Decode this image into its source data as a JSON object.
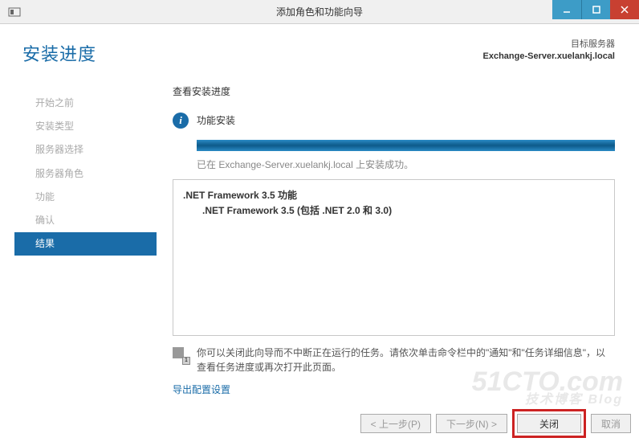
{
  "window": {
    "title": "添加角色和功能向导"
  },
  "page": {
    "heading": "安装进度"
  },
  "dest": {
    "label": "目标服务器",
    "server": "Exchange-Server.xuelankj.local"
  },
  "nav": {
    "items": [
      {
        "label": "开始之前"
      },
      {
        "label": "安装类型"
      },
      {
        "label": "服务器选择"
      },
      {
        "label": "服务器角色"
      },
      {
        "label": "功能"
      },
      {
        "label": "确认"
      },
      {
        "label": "结果",
        "active": true
      }
    ]
  },
  "progress": {
    "section_label": "查看安装进度",
    "status": "功能安装",
    "message": "已在 Exchange-Server.xuelankj.local 上安装成功。"
  },
  "details": {
    "line1": ".NET Framework 3.5 功能",
    "line2": ".NET Framework 3.5 (包括 .NET 2.0 和 3.0)"
  },
  "note": {
    "text": "你可以关闭此向导而不中断正在运行的任务。请依次单击命令栏中的\"通知\"和\"任务详细信息\"，以查看任务进度或再次打开此页面。",
    "badge": "1"
  },
  "links": {
    "export": "导出配置设置"
  },
  "buttons": {
    "prev": "< 上一步(P)",
    "next": "下一步(N) >",
    "close": "关闭",
    "cancel": "取消"
  },
  "watermark": {
    "main": "51CTO.com",
    "sub": "技术博客 Blog"
  }
}
